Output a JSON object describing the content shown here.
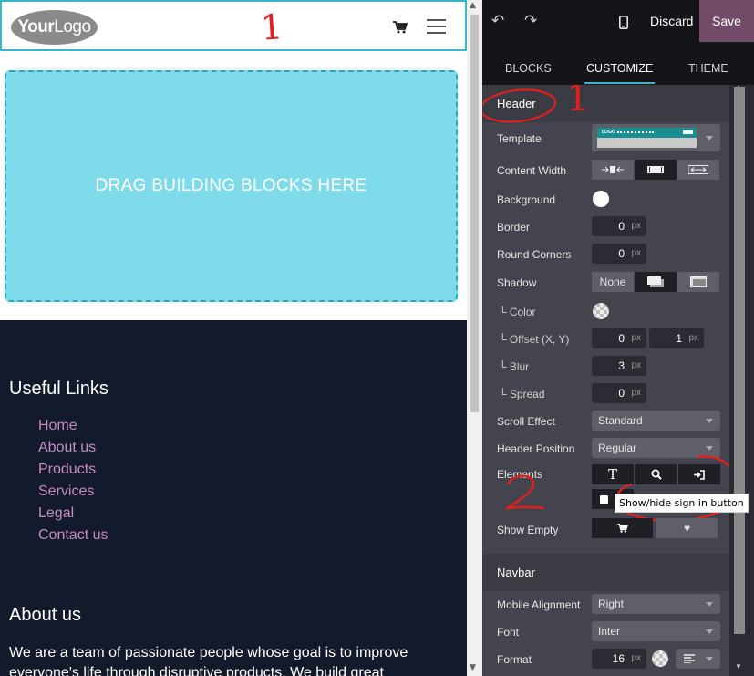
{
  "preview": {
    "logo_bold": "Your",
    "logo_light": "Logo",
    "annotation_one": "1",
    "drop_zone_text": "DRAG BUILDING BLOCKS HERE",
    "footer": {
      "useful_links_title": "Useful Links",
      "useful_links": [
        "Home",
        "About us",
        "Products",
        "Services",
        "Legal",
        "Contact us"
      ],
      "about_title": "About us",
      "about_text": "We are a team of passionate people whose goal is to improve everyone's life through disruptive products. We build great"
    }
  },
  "topbar": {
    "undo_icon": "undo-icon",
    "redo_icon": "redo-icon",
    "mobile_icon": "mobile-phone-icon",
    "discard_label": "Discard",
    "save_label": "Save"
  },
  "tabs": [
    {
      "label": "BLOCKS",
      "active": false
    },
    {
      "label": "CUSTOMIZE",
      "active": true
    },
    {
      "label": "THEME",
      "active": false
    }
  ],
  "header_section": {
    "title": "Header",
    "annotation": "1",
    "template_label": "Template",
    "template_preview_logo": "LOGO",
    "content_width_label": "Content Width",
    "background_label": "Background",
    "background_color": "#ffffff",
    "border_label": "Border",
    "border_value": "0",
    "round_corners_label": "Round Corners",
    "round_corners_value": "0",
    "unit": "px",
    "shadow_label": "Shadow",
    "shadow_none": "None",
    "color_label": "└ Color",
    "offset_label": "└ Offset (X, Y)",
    "offset_x": "0",
    "offset_y": "1",
    "blur_label": "└ Blur",
    "blur_value": "3",
    "spread_label": "└ Spread",
    "spread_value": "0",
    "scroll_effect_label": "Scroll Effect",
    "scroll_effect_value": "Standard",
    "header_position_label": "Header Position",
    "header_position_value": "Regular",
    "elements_label": "Elements",
    "elements_annotation": "2",
    "show_empty_label": "Show Empty",
    "tooltip": "Show/hide sign in button"
  },
  "navbar_section": {
    "title": "Navbar",
    "mobile_alignment_label": "Mobile Alignment",
    "mobile_alignment_value": "Right",
    "font_label": "Font",
    "font_value": "Inter",
    "format_label": "Format",
    "format_value": "16",
    "unit": "px"
  },
  "colors": {
    "accent": "#3bb6c8",
    "save": "#714b67",
    "link": "#c58bc3",
    "annotation": "#e02020",
    "footer_bg": "#131a2b"
  }
}
